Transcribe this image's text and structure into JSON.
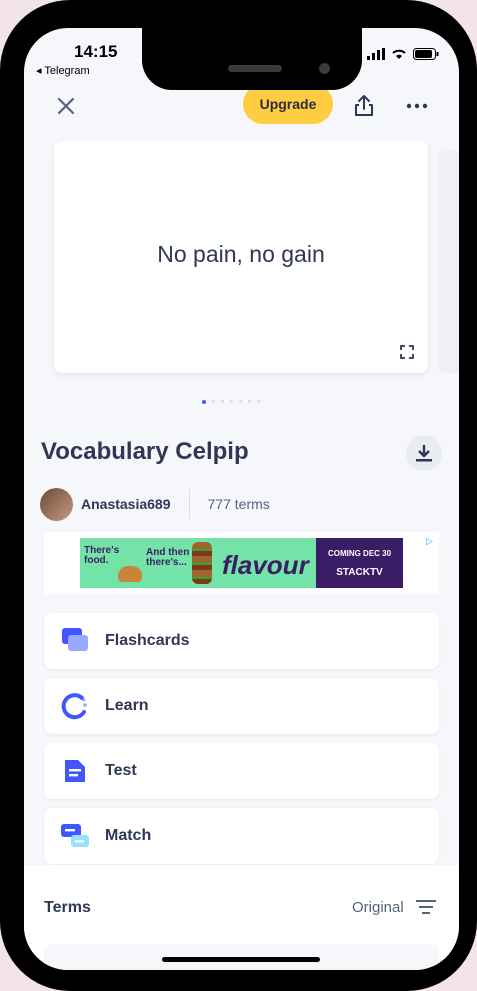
{
  "status": {
    "time": "14:15",
    "back_app": "◂ Telegram"
  },
  "toolbar": {
    "upgrade_label": "Upgrade"
  },
  "card": {
    "text": "No pain, no gain"
  },
  "set": {
    "title": "Vocabulary Celpip",
    "author": "Anastasia689",
    "term_count": "777 terms"
  },
  "ad": {
    "line1a": "There's",
    "line1b": "food.",
    "line2a": "And then",
    "line2b": "there's...",
    "brand": "flavour",
    "right1": "COMING DEC 30",
    "right2": "STACKTV"
  },
  "study_modes": [
    {
      "label": "Flashcards",
      "icon": "flashcards-icon"
    },
    {
      "label": "Learn",
      "icon": "learn-icon"
    },
    {
      "label": "Test",
      "icon": "test-icon"
    },
    {
      "label": "Match",
      "icon": "match-icon"
    }
  ],
  "terms": {
    "label": "Terms",
    "sort": "Original"
  },
  "colors": {
    "accent": "#4255ff",
    "upgrade": "#ffcd3f",
    "text": "#2e3856"
  }
}
